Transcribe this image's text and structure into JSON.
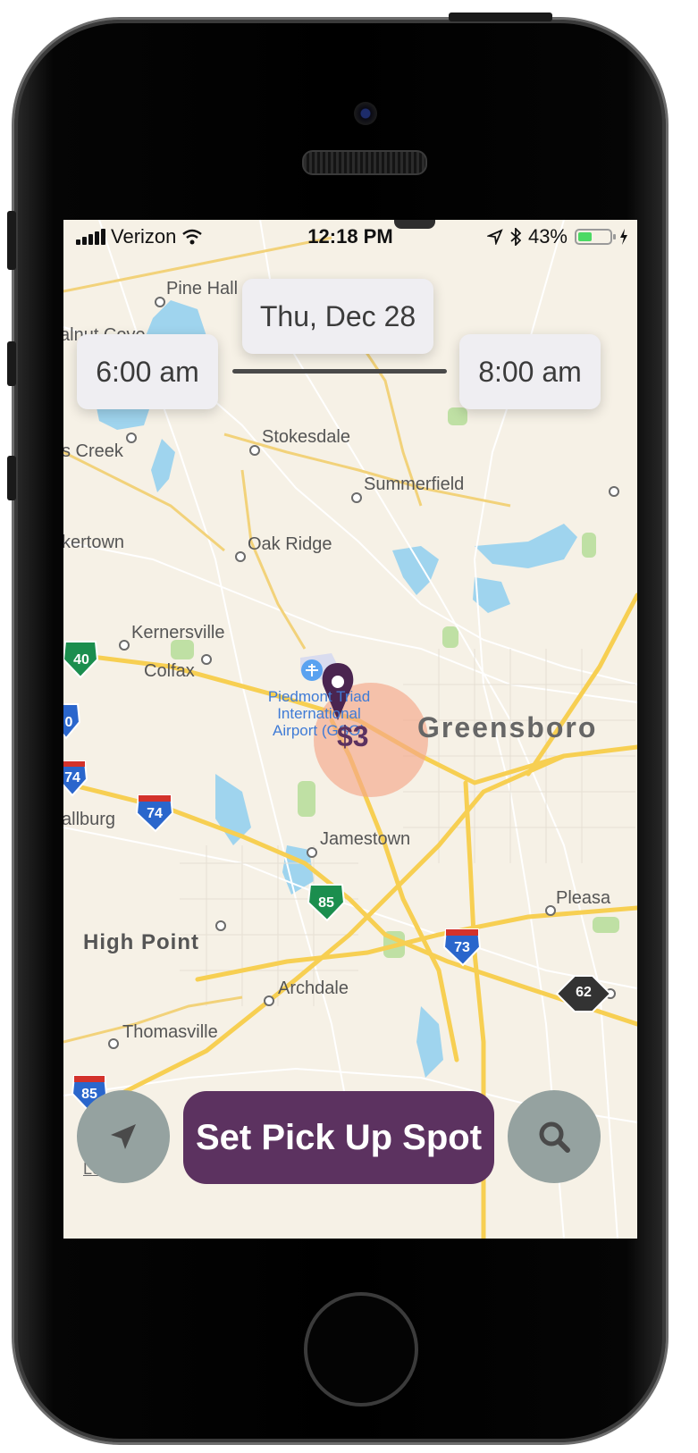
{
  "status_bar": {
    "carrier": "Verizon",
    "time": "12:18 PM",
    "battery_percent": "43%",
    "battery_level": 0.43
  },
  "time_picker": {
    "date": "Thu, Dec 28",
    "start_time": "6:00 am",
    "end_time": "8:00 am"
  },
  "map": {
    "places": [
      {
        "name": "Pine Hall"
      },
      {
        "name": "alnut Cove"
      },
      {
        "name": "s Creek"
      },
      {
        "name": "Stokesdale"
      },
      {
        "name": "Summerfield"
      },
      {
        "name": "kertown"
      },
      {
        "name": "Oak Ridge"
      },
      {
        "name": "Kernersville"
      },
      {
        "name": "Colfax"
      },
      {
        "name": "Greensboro"
      },
      {
        "name": "allburg"
      },
      {
        "name": "Jamestown"
      },
      {
        "name": "High Point"
      },
      {
        "name": "Pleasa"
      },
      {
        "name": "Archdale"
      },
      {
        "name": "Thomasville"
      }
    ],
    "airport_label": [
      "Piedmont Triad",
      "International",
      "Airport (GSO)"
    ],
    "shields": [
      {
        "number": "40",
        "type": "interstate"
      },
      {
        "number": "0",
        "type": "interstate"
      },
      {
        "number": "74",
        "type": "interstate"
      },
      {
        "number": "74",
        "type": "interstate"
      },
      {
        "number": "85",
        "type": "interstate"
      },
      {
        "number": "73",
        "type": "interstate"
      },
      {
        "number": "62",
        "type": "state"
      },
      {
        "number": "85",
        "type": "interstate"
      }
    ],
    "pin_price": "$3",
    "legal_label": "Legal"
  },
  "actions": {
    "cta_label": "Set Pick Up Spot",
    "locate_icon": "location-arrow-icon",
    "search_icon": "search-icon"
  },
  "colors": {
    "brand_purple": "#5c3260",
    "fab_gray": "#95a2a0",
    "map_land": "#f5efe3",
    "road_major": "#f7cf52",
    "water": "#9fd4ee"
  }
}
